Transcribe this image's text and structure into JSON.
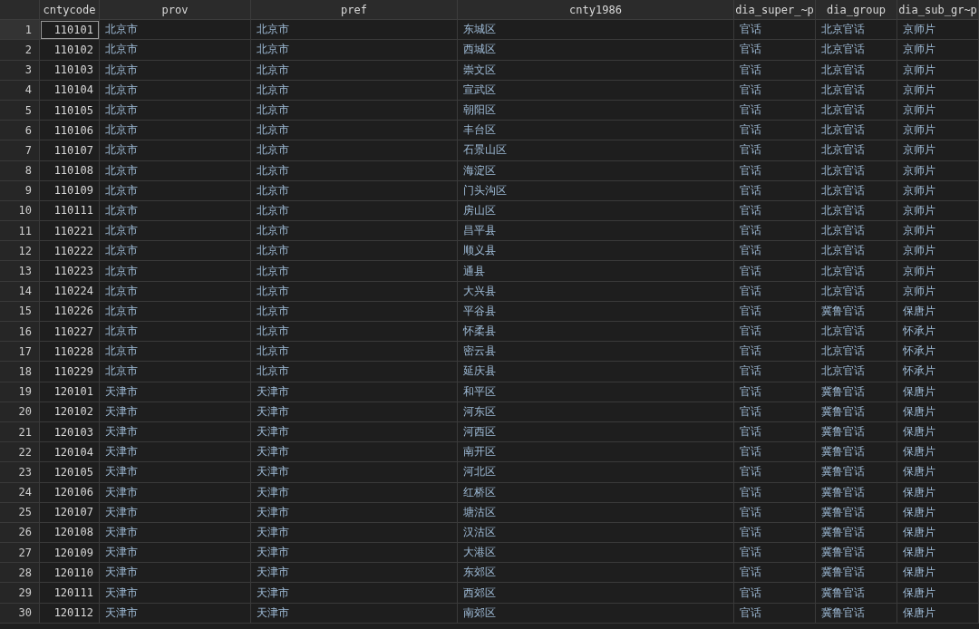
{
  "table": {
    "columns": [
      "cntycode",
      "prov",
      "pref",
      "cnty1986",
      "dia_super_~p",
      "dia_group",
      "dia_sub_gr~p"
    ],
    "rows": [
      {
        "number": "1",
        "selected": true,
        "cells": [
          "110101",
          "北京市",
          "北京市",
          "东城区",
          "官话",
          "北京官话",
          "京师片"
        ]
      },
      {
        "number": "2",
        "selected": false,
        "cells": [
          "110102",
          "北京市",
          "北京市",
          "西城区",
          "官话",
          "北京官话",
          "京师片"
        ]
      },
      {
        "number": "3",
        "selected": false,
        "cells": [
          "110103",
          "北京市",
          "北京市",
          "崇文区",
          "官话",
          "北京官话",
          "京师片"
        ]
      },
      {
        "number": "4",
        "selected": false,
        "cells": [
          "110104",
          "北京市",
          "北京市",
          "宣武区",
          "官话",
          "北京官话",
          "京师片"
        ]
      },
      {
        "number": "5",
        "selected": false,
        "cells": [
          "110105",
          "北京市",
          "北京市",
          "朝阳区",
          "官话",
          "北京官话",
          "京师片"
        ]
      },
      {
        "number": "6",
        "selected": false,
        "cells": [
          "110106",
          "北京市",
          "北京市",
          "丰台区",
          "官话",
          "北京官话",
          "京师片"
        ]
      },
      {
        "number": "7",
        "selected": false,
        "cells": [
          "110107",
          "北京市",
          "北京市",
          "石景山区",
          "官话",
          "北京官话",
          "京师片"
        ]
      },
      {
        "number": "8",
        "selected": false,
        "cells": [
          "110108",
          "北京市",
          "北京市",
          "海淀区",
          "官话",
          "北京官话",
          "京师片"
        ]
      },
      {
        "number": "9",
        "selected": false,
        "cells": [
          "110109",
          "北京市",
          "北京市",
          "门头沟区",
          "官话",
          "北京官话",
          "京师片"
        ]
      },
      {
        "number": "10",
        "selected": false,
        "cells": [
          "110111",
          "北京市",
          "北京市",
          "房山区",
          "官话",
          "北京官话",
          "京师片"
        ]
      },
      {
        "number": "11",
        "selected": false,
        "cells": [
          "110221",
          "北京市",
          "北京市",
          "昌平县",
          "官话",
          "北京官话",
          "京师片"
        ]
      },
      {
        "number": "12",
        "selected": false,
        "cells": [
          "110222",
          "北京市",
          "北京市",
          "顺义县",
          "官话",
          "北京官话",
          "京师片"
        ]
      },
      {
        "number": "13",
        "selected": false,
        "cells": [
          "110223",
          "北京市",
          "北京市",
          "通县",
          "官话",
          "北京官话",
          "京师片"
        ]
      },
      {
        "number": "14",
        "selected": false,
        "cells": [
          "110224",
          "北京市",
          "北京市",
          "大兴县",
          "官话",
          "北京官话",
          "京师片"
        ]
      },
      {
        "number": "15",
        "selected": false,
        "cells": [
          "110226",
          "北京市",
          "北京市",
          "平谷县",
          "官话",
          "冀鲁官话",
          "保唐片"
        ]
      },
      {
        "number": "16",
        "selected": false,
        "cells": [
          "110227",
          "北京市",
          "北京市",
          "怀柔县",
          "官话",
          "北京官话",
          "怀承片"
        ]
      },
      {
        "number": "17",
        "selected": false,
        "cells": [
          "110228",
          "北京市",
          "北京市",
          "密云县",
          "官话",
          "北京官话",
          "怀承片"
        ]
      },
      {
        "number": "18",
        "selected": false,
        "cells": [
          "110229",
          "北京市",
          "北京市",
          "延庆县",
          "官话",
          "北京官话",
          "怀承片"
        ]
      },
      {
        "number": "19",
        "selected": false,
        "cells": [
          "120101",
          "天津市",
          "天津市",
          "和平区",
          "官话",
          "冀鲁官话",
          "保唐片"
        ]
      },
      {
        "number": "20",
        "selected": false,
        "cells": [
          "120102",
          "天津市",
          "天津市",
          "河东区",
          "官话",
          "冀鲁官话",
          "保唐片"
        ]
      },
      {
        "number": "21",
        "selected": false,
        "cells": [
          "120103",
          "天津市",
          "天津市",
          "河西区",
          "官话",
          "冀鲁官话",
          "保唐片"
        ]
      },
      {
        "number": "22",
        "selected": false,
        "cells": [
          "120104",
          "天津市",
          "天津市",
          "南开区",
          "官话",
          "冀鲁官话",
          "保唐片"
        ]
      },
      {
        "number": "23",
        "selected": false,
        "cells": [
          "120105",
          "天津市",
          "天津市",
          "河北区",
          "官话",
          "冀鲁官话",
          "保唐片"
        ]
      },
      {
        "number": "24",
        "selected": false,
        "cells": [
          "120106",
          "天津市",
          "天津市",
          "红桥区",
          "官话",
          "冀鲁官话",
          "保唐片"
        ]
      },
      {
        "number": "25",
        "selected": false,
        "cells": [
          "120107",
          "天津市",
          "天津市",
          "塘沽区",
          "官话",
          "冀鲁官话",
          "保唐片"
        ]
      },
      {
        "number": "26",
        "selected": false,
        "cells": [
          "120108",
          "天津市",
          "天津市",
          "汉沽区",
          "官话",
          "冀鲁官话",
          "保唐片"
        ]
      },
      {
        "number": "27",
        "selected": false,
        "cells": [
          "120109",
          "天津市",
          "天津市",
          "大港区",
          "官话",
          "冀鲁官话",
          "保唐片"
        ]
      },
      {
        "number": "28",
        "selected": false,
        "cells": [
          "120110",
          "天津市",
          "天津市",
          "东郊区",
          "官话",
          "冀鲁官话",
          "保唐片"
        ]
      },
      {
        "number": "29",
        "selected": false,
        "cells": [
          "120111",
          "天津市",
          "天津市",
          "西郊区",
          "官话",
          "冀鲁官话",
          "保唐片"
        ]
      },
      {
        "number": "30",
        "selected": false,
        "cells": [
          "120112",
          "天津市",
          "天津市",
          "南郊区",
          "官话",
          "冀鲁官话",
          "保唐片"
        ]
      }
    ]
  }
}
